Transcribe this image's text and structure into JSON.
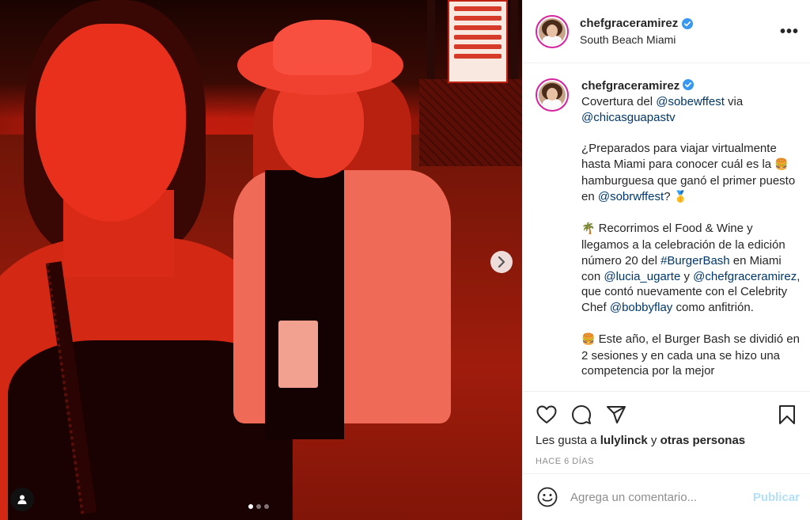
{
  "post": {
    "username": "chefgraceramirez",
    "location": "South Beach Miami",
    "more_icon": "more-options-icon"
  },
  "caption": {
    "username": "chefgraceramirez",
    "line1_text": "Covertura del ",
    "line1_mention": "@sobewffest",
    "line1_via": " via",
    "line2_mention": "@chicasguapastv",
    "p2_text_a": "¿Preparados para viajar virtualmente hasta Miami para conocer cuál es la ",
    "p2_emoji_burger": "🍔",
    "p2_text_b": " hamburguesa que ganó el primer puesto en ",
    "p2_mention": "@sobrwffest",
    "p2_text_c": "? ",
    "p2_emoji_medal": "🥇",
    "p3_emoji_palm": "🌴",
    "p3_text_a": " Recorrimos el Food & Wine y llegamos a la celebración de la edición número 20 del ",
    "p3_hashtag": "#BurgerBash",
    "p3_text_b": " en Miami con ",
    "p3_mention1": "@lucia_ugarte",
    "p3_text_c": " y ",
    "p3_mention2": "@chefgraceramirez",
    "p3_text_d": ", que contó nuevamente con el Celebrity Chef ",
    "p3_mention3": "@bobbyflay",
    "p3_text_e": " como anfitrión.",
    "p4_emoji_burger": "🍔",
    "p4_text": " Este año, el Burger Bash se dividió en 2 sesiones y en cada una se hizo una competencia por la mejor"
  },
  "engagement": {
    "likes_prefix": "Les gusta a ",
    "likes_user": "lulylinck",
    "likes_middle": " y ",
    "likes_others": "otras personas",
    "timestamp": "HACE 6 DÍAS"
  },
  "comment": {
    "placeholder": "Agrega un comentario...",
    "publish_label": "Publicar"
  },
  "carousel": {
    "total_slides": 3,
    "current_slide": 1
  },
  "colors": {
    "mention": "#00376b",
    "verified": "#3897f0",
    "publish_disabled": "#b2dffc",
    "avatar_ring": "#d6249f"
  }
}
